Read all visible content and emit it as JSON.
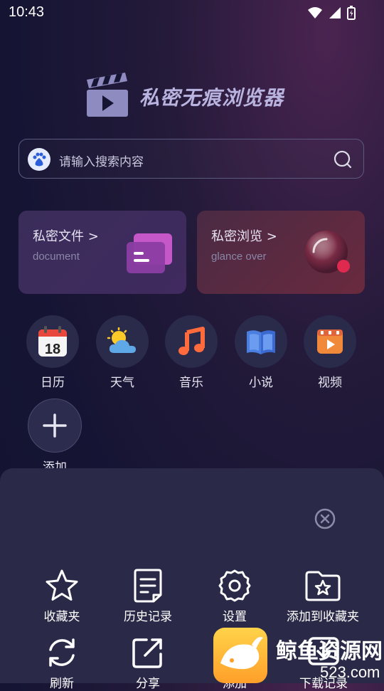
{
  "status_bar": {
    "time": "10:43"
  },
  "app": {
    "title": "私密无痕浏览器"
  },
  "search": {
    "placeholder": "请输入搜索内容"
  },
  "cards": [
    {
      "title": "私密文件 >",
      "subtitle": "document",
      "icon": "folder-icon"
    },
    {
      "title": "私密浏览 >",
      "subtitle": "glance over",
      "icon": "orb-icon"
    }
  ],
  "quick_links": [
    {
      "label": "日历",
      "icon": "calendar-icon",
      "day": "18"
    },
    {
      "label": "天气",
      "icon": "weather-icon"
    },
    {
      "label": "音乐",
      "icon": "music-icon"
    },
    {
      "label": "小说",
      "icon": "book-icon"
    },
    {
      "label": "视频",
      "icon": "video-icon"
    },
    {
      "label": "添加",
      "icon": "plus-icon"
    }
  ],
  "menu": [
    {
      "label": "收藏夹",
      "icon": "star-icon"
    },
    {
      "label": "历史记录",
      "icon": "history-icon"
    },
    {
      "label": "设置",
      "icon": "gear-icon"
    },
    {
      "label": "添加到收藏夹",
      "icon": "folder-star-icon"
    },
    {
      "label": "刷新",
      "icon": "refresh-icon"
    },
    {
      "label": "分享",
      "icon": "share-icon"
    },
    {
      "label": "添加",
      "icon": "add-icon"
    },
    {
      "label": "下载记录",
      "icon": "download-icon"
    }
  ],
  "watermark": {
    "brand": "鲸鱼资源网",
    "domain": "523.com"
  },
  "colors": {
    "accent": "#b8b4df",
    "sheet": "#2a2a48",
    "music": "#ff6b3d",
    "book": "#4a7fe0",
    "video": "#f08a3a"
  }
}
